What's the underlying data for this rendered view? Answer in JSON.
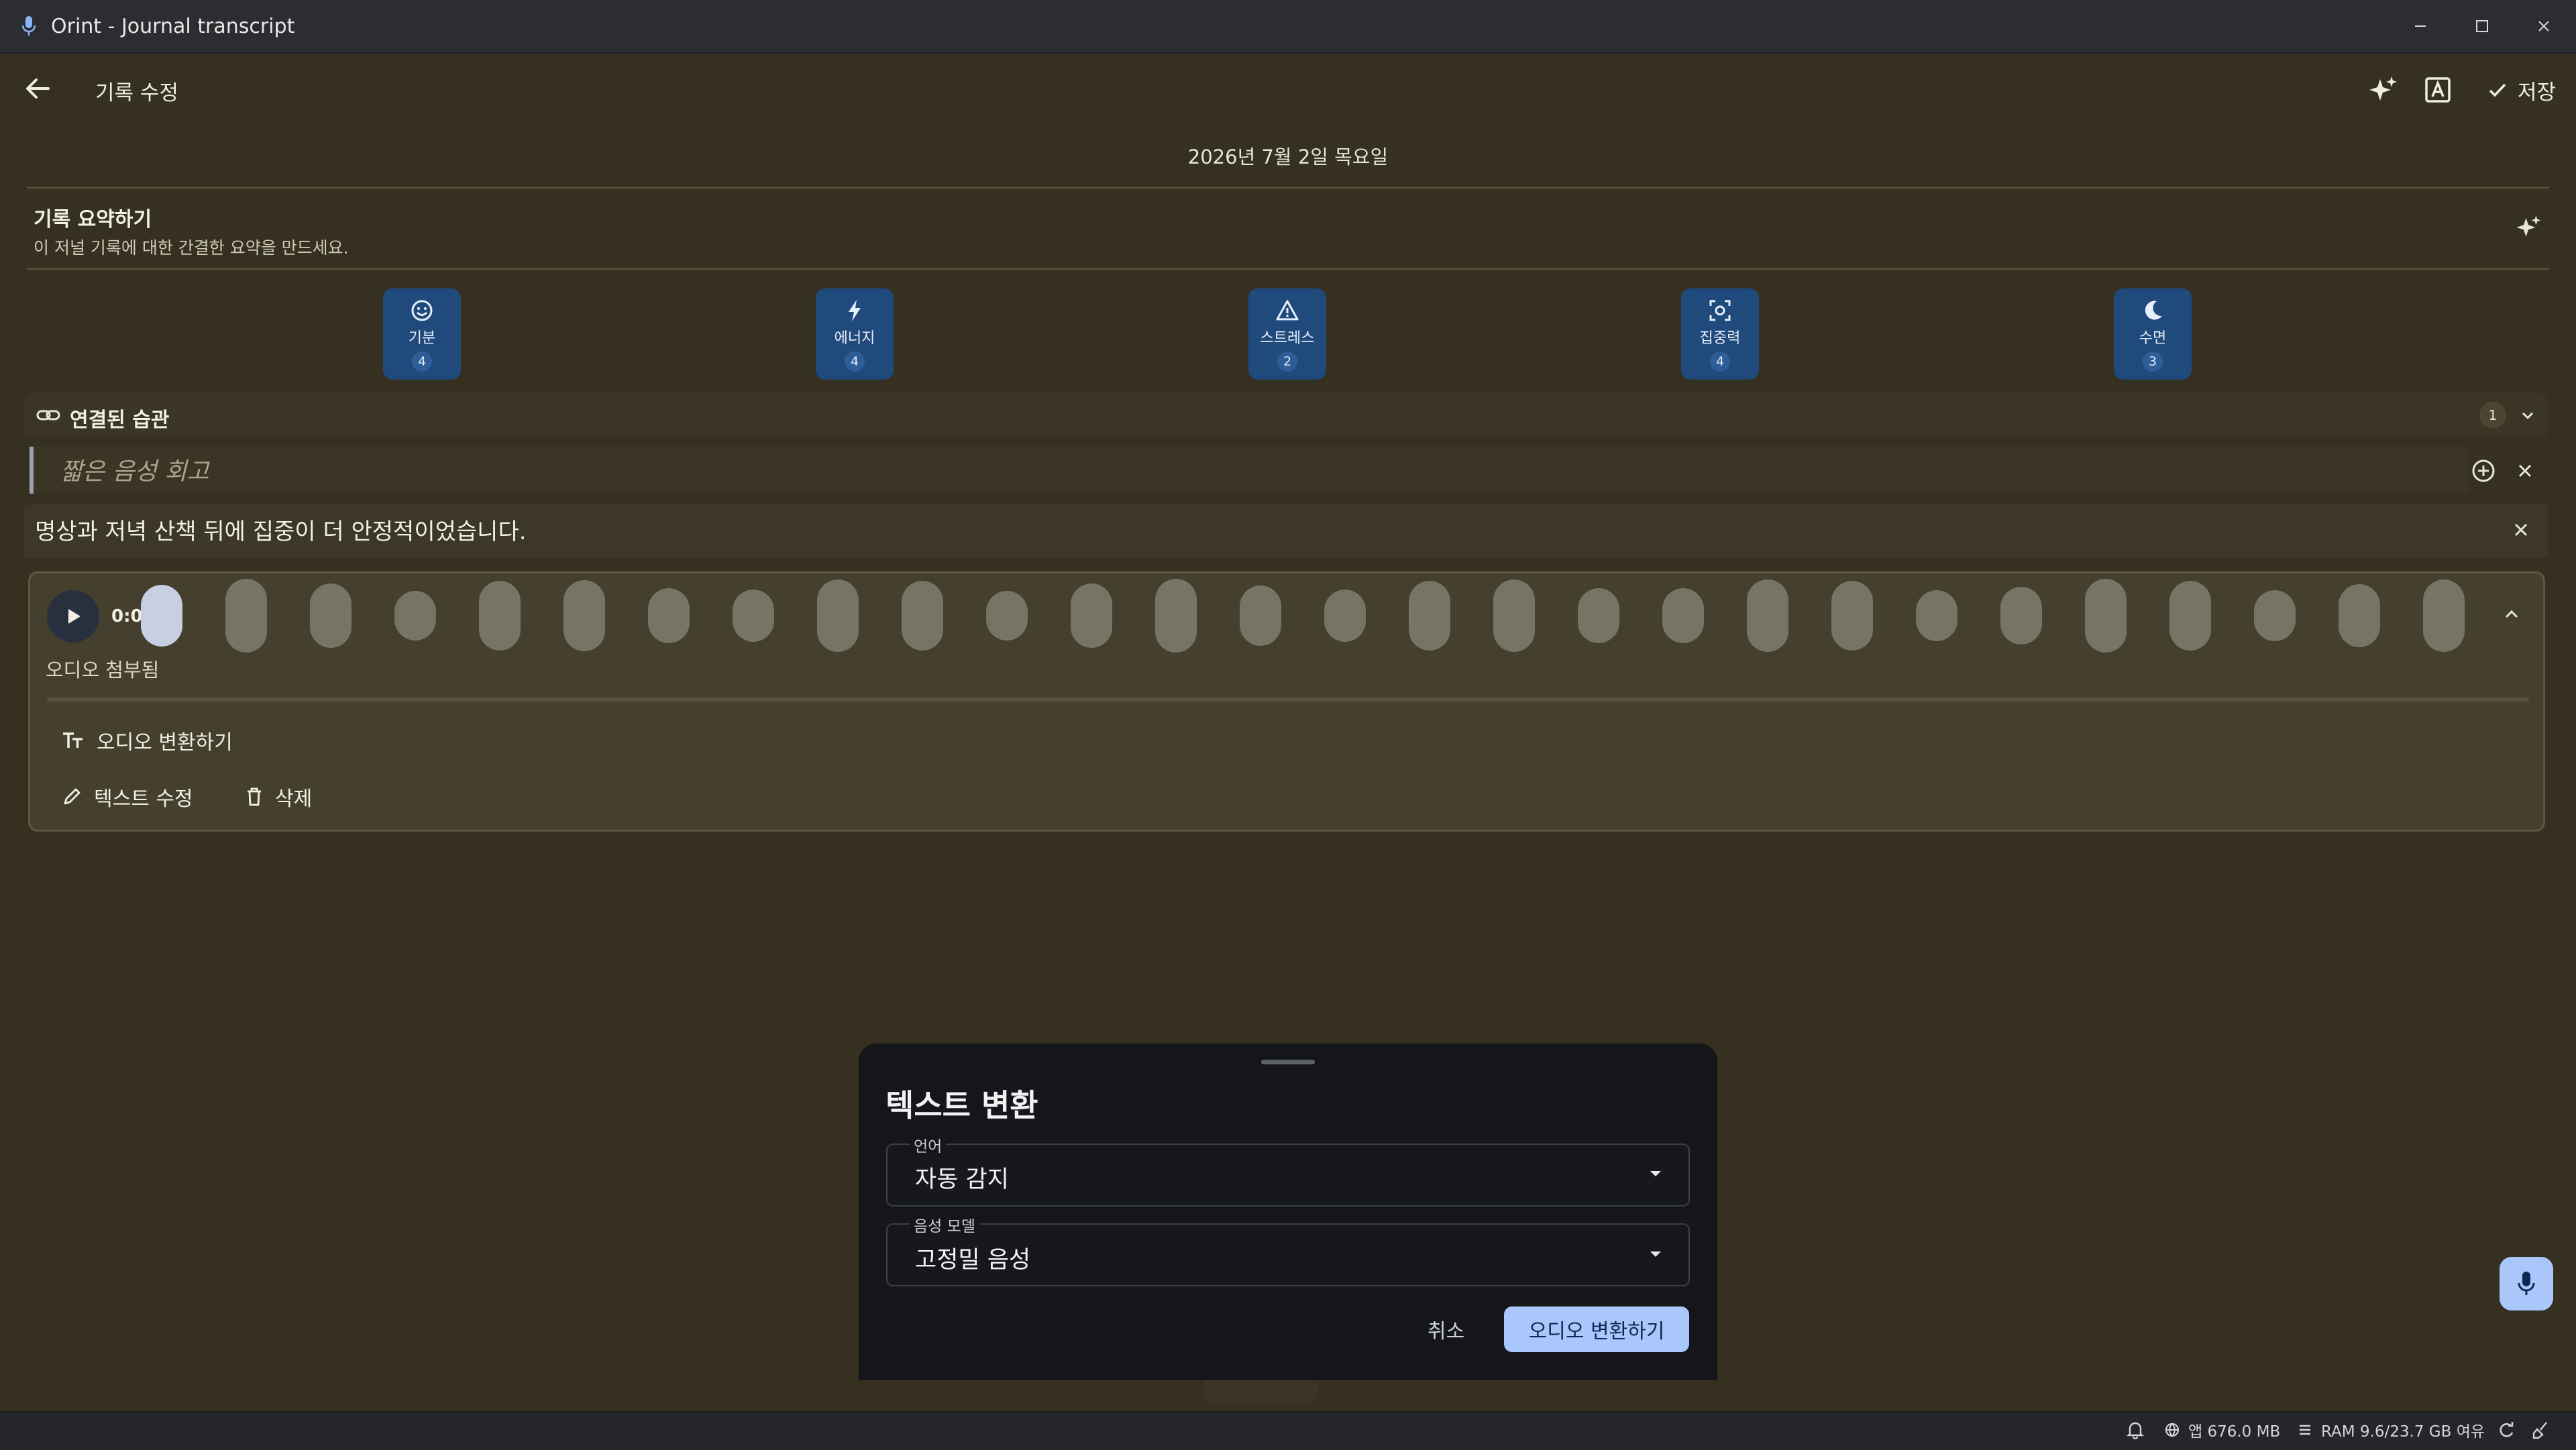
{
  "window": {
    "title": "Orint - Journal transcript"
  },
  "appbar": {
    "title": "기록 수정",
    "save_label": "저장"
  },
  "entry": {
    "date": "2026년 7월 2일 목요일"
  },
  "summary": {
    "title": "기록 요약하기",
    "subtitle": "이 저널 기록에 대한 간결한 요약을 만드세요."
  },
  "metrics": [
    {
      "label": "기분",
      "value": "4",
      "icon": "smile-icon"
    },
    {
      "label": "에너지",
      "value": "4",
      "icon": "bolt-icon"
    },
    {
      "label": "스트레스",
      "value": "2",
      "icon": "warning-icon"
    },
    {
      "label": "집중력",
      "value": "4",
      "icon": "focus-icon"
    },
    {
      "label": "수면",
      "value": "3",
      "icon": "moon-icon"
    }
  ],
  "habits": {
    "label": "연결된 습관",
    "count": "1"
  },
  "voice_title": {
    "placeholder": "짧은 음성 회고"
  },
  "text_block": {
    "text": "명상과 저녁 산책 뒤에 집중이 더 안정적이었습니다."
  },
  "audio": {
    "time": "0:04",
    "label": "오디오 첨부됨",
    "progress": 0.03,
    "actions": {
      "transcribe": "오디오 변환하기",
      "edit_text": "텍스트 수정",
      "delete": "삭제"
    }
  },
  "sheet": {
    "title": "텍스트 변환",
    "language_label": "언어",
    "language_value": "자동 감지",
    "model_label": "음성 모델",
    "model_value": "고정밀 음성",
    "cancel": "취소",
    "confirm": "오디오 변환하기"
  },
  "statusbar": {
    "app_memory": "앱 676.0 MB",
    "ram": "RAM 9.6/23.7 GB 여유"
  },
  "colors": {
    "background": "#353020",
    "metric_tile": "#214a7c",
    "primary_button": "#a9c7fa",
    "sheet": "#141619"
  }
}
